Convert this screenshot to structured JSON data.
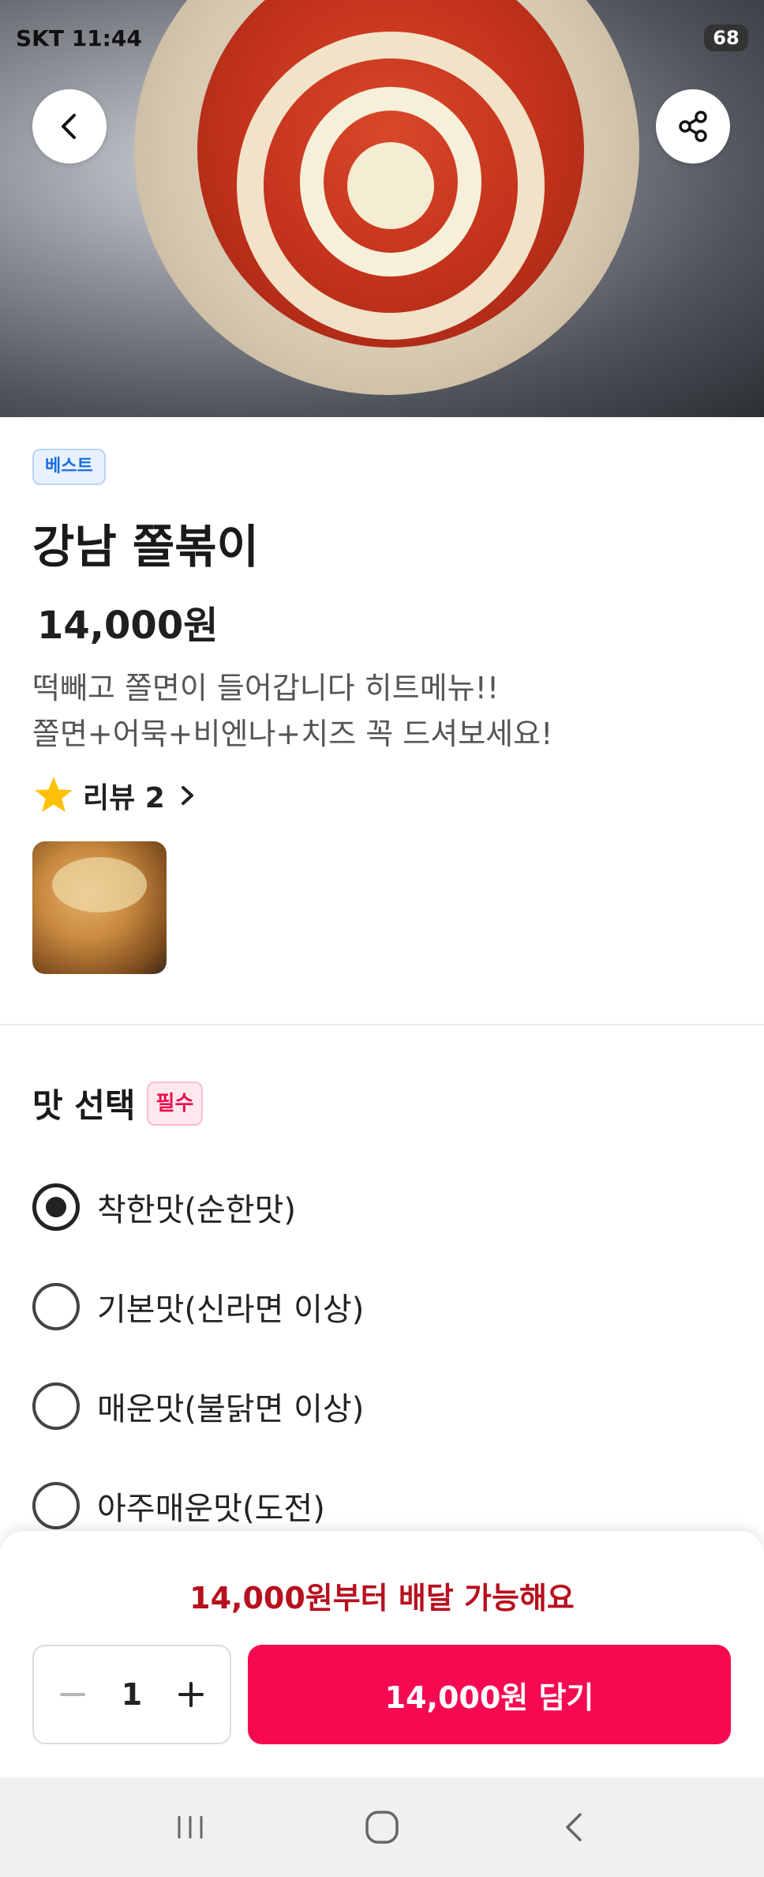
{
  "status_bar": {
    "carrier_time": "SKT 11:44",
    "battery": "68"
  },
  "header": {
    "back_icon": "chevron-left-icon",
    "share_icon": "share-icon"
  },
  "product": {
    "badge": "베스트",
    "name": "강남 쫄볶이",
    "price": "14,000원",
    "description_line1": "떡빼고 쫄면이 들어갑니다 히트메뉴!!",
    "description_line2": "쫄면+어묵+비엔나+치즈 꼭 드셔보세요!",
    "review_label": "리뷰 2",
    "star_color": "#FFC107"
  },
  "options": {
    "title": "맛 선택",
    "required_badge": "필수",
    "items": [
      {
        "label": "착한맛(순한맛)",
        "selected": true
      },
      {
        "label": "기본맛(신라면 이상)",
        "selected": false
      },
      {
        "label": "매운맛(불닭면 이상)",
        "selected": false
      },
      {
        "label": "아주매운맛(도전)",
        "selected": false
      }
    ]
  },
  "bottom_sheet": {
    "min_order_note": "14,000원부터 배달 가능해요",
    "quantity": "1",
    "add_button": "14,000원 담기",
    "accent_color": "#F50A52"
  },
  "nav": {
    "recent_icon": "recent-apps-icon",
    "home_icon": "home-icon",
    "back_icon": "back-icon"
  }
}
